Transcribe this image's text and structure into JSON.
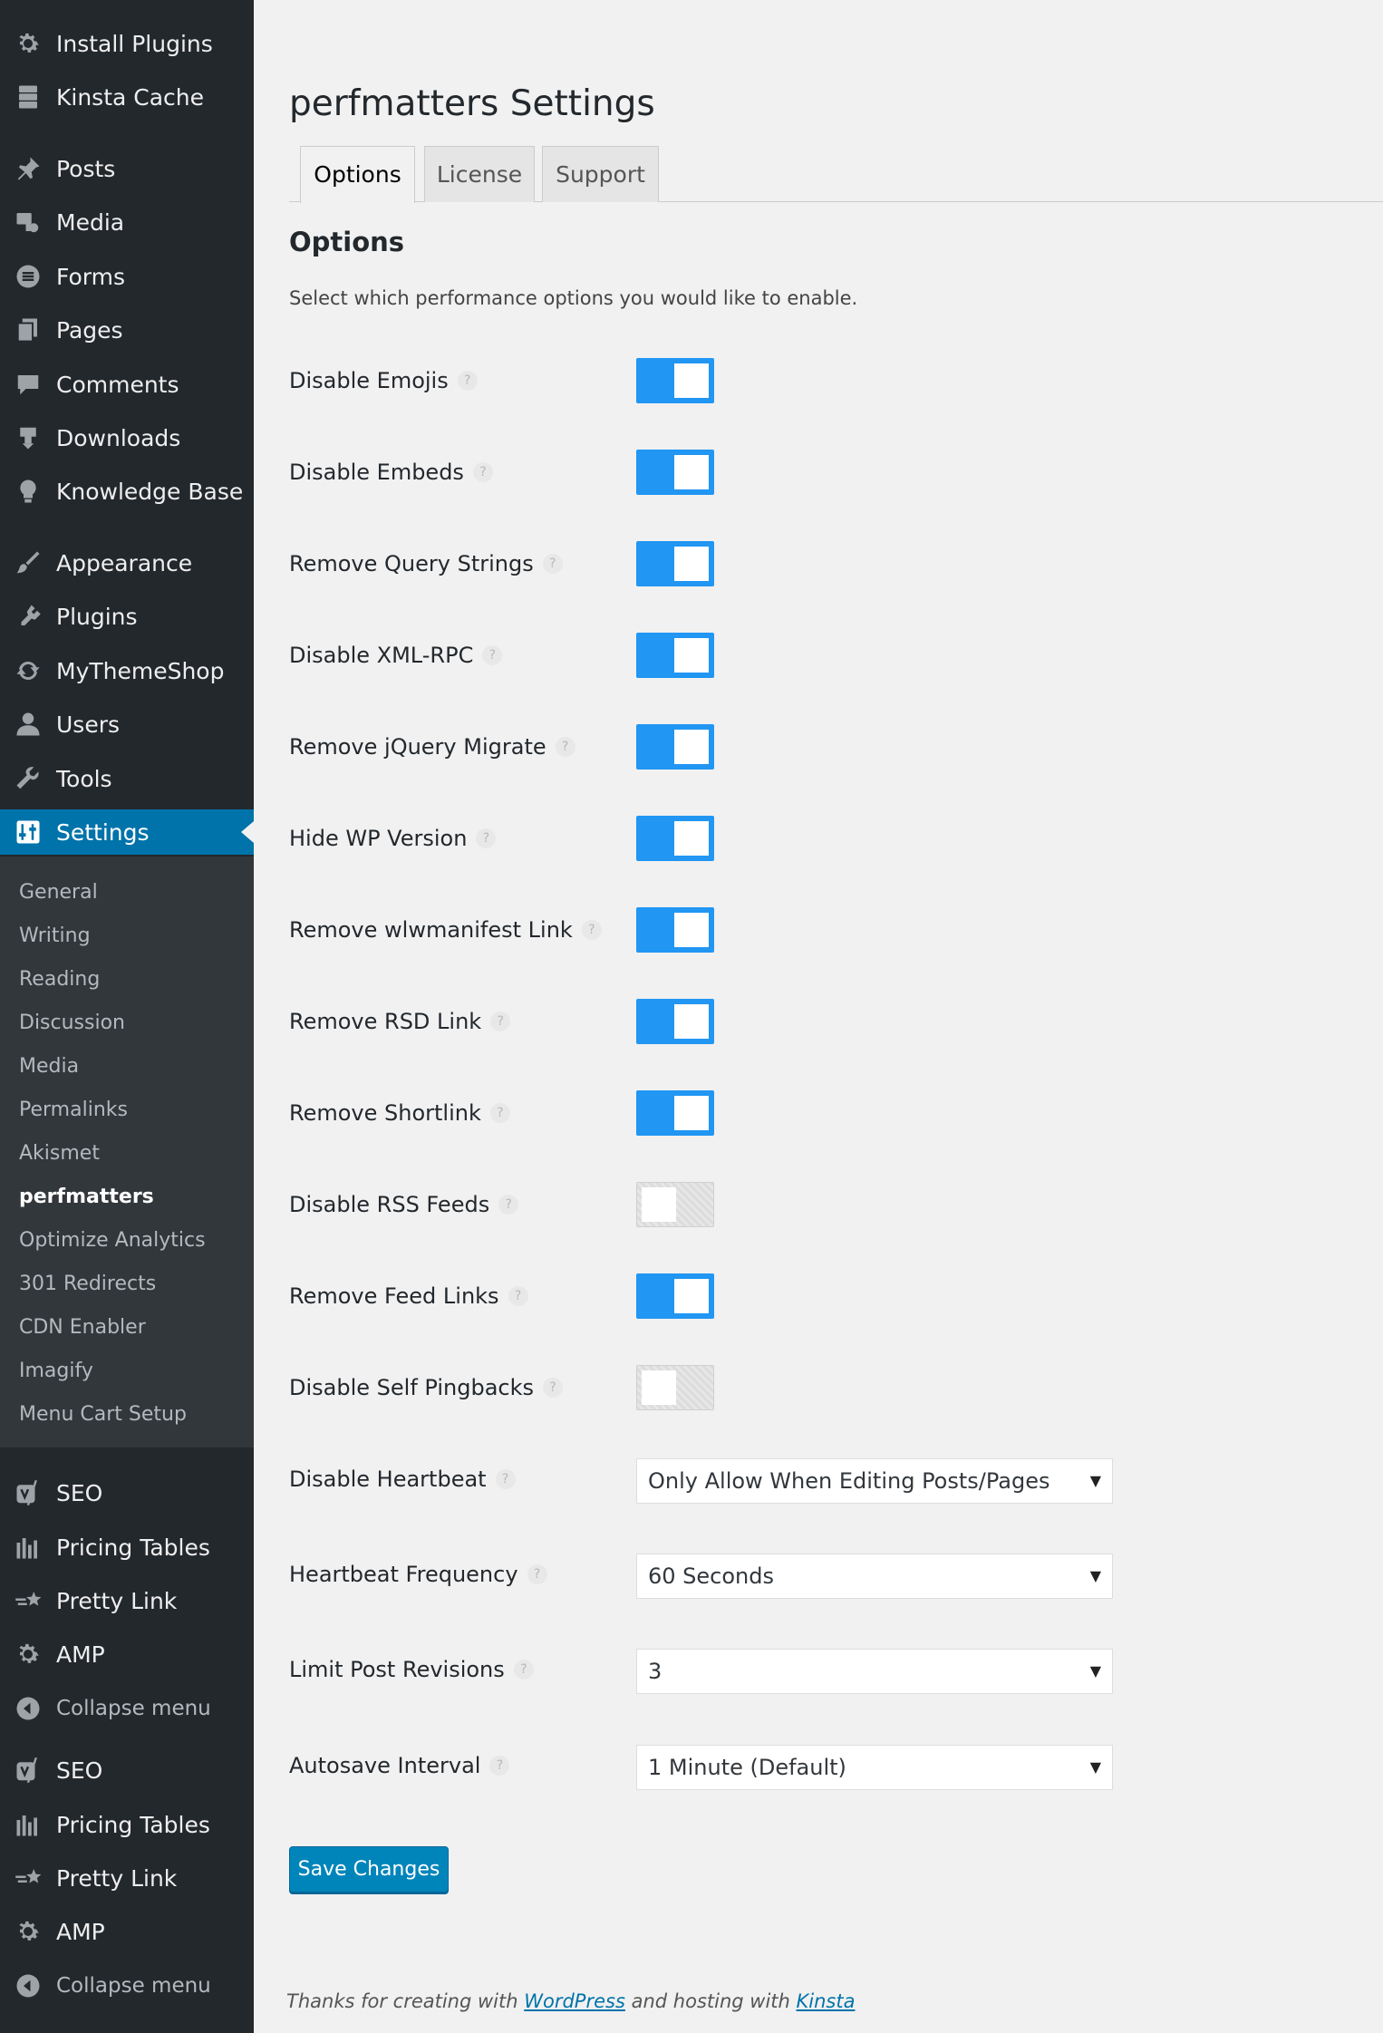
{
  "sidebar": {
    "top_items": [
      {
        "label": "Install Plugins",
        "icon": "gear-icon"
      },
      {
        "label": "Kinsta Cache",
        "icon": "server-icon"
      },
      {
        "label": "Posts",
        "icon": "pushpin-icon"
      },
      {
        "label": "Media",
        "icon": "media-icon"
      },
      {
        "label": "Forms",
        "icon": "forms-icon"
      },
      {
        "label": "Pages",
        "icon": "pages-icon"
      },
      {
        "label": "Comments",
        "icon": "comment-icon"
      },
      {
        "label": "Downloads",
        "icon": "download-icon"
      },
      {
        "label": "Knowledge Base",
        "icon": "lightbulb-icon"
      },
      {
        "label": "Appearance",
        "icon": "paintbrush-icon"
      },
      {
        "label": "Plugins",
        "icon": "plug-icon"
      },
      {
        "label": "MyThemeShop",
        "icon": "refresh-icon"
      },
      {
        "label": "Users",
        "icon": "user-icon"
      },
      {
        "label": "Tools",
        "icon": "wrench-icon"
      },
      {
        "label": "Settings",
        "icon": "settings-sliders-icon"
      }
    ],
    "submenu": [
      "General",
      "Writing",
      "Reading",
      "Discussion",
      "Media",
      "Permalinks",
      "Akismet",
      "perfmatters",
      "Optimize Analytics",
      "301 Redirects",
      "CDN Enabler",
      "Imagify",
      "Menu Cart Setup"
    ],
    "bottom_items": [
      {
        "label": "SEO",
        "icon": "yoast-icon"
      },
      {
        "label": "Pricing Tables",
        "icon": "bar-chart-icon"
      },
      {
        "label": "Pretty Link",
        "icon": "star-link-icon"
      },
      {
        "label": "AMP",
        "icon": "gear-icon"
      },
      {
        "label": "Collapse menu",
        "icon": "collapse-arrow-icon"
      },
      {
        "label": "SEO",
        "icon": "yoast-icon"
      },
      {
        "label": "Pricing Tables",
        "icon": "bar-chart-icon"
      },
      {
        "label": "Pretty Link",
        "icon": "star-link-icon"
      },
      {
        "label": "AMP",
        "icon": "gear-icon"
      },
      {
        "label": "Collapse menu",
        "icon": "collapse-arrow-icon"
      }
    ]
  },
  "page": {
    "title": "perfmatters Settings",
    "tabs": [
      "Options",
      "License",
      "Support"
    ],
    "section_title": "Options",
    "section_desc": "Select which performance options you would like to enable.",
    "help_glyph": "?"
  },
  "toggles": [
    {
      "label": "Disable Emojis",
      "enabled": true
    },
    {
      "label": "Disable Embeds",
      "enabled": true
    },
    {
      "label": "Remove Query Strings",
      "enabled": true
    },
    {
      "label": "Disable XML-RPC",
      "enabled": true
    },
    {
      "label": "Remove jQuery Migrate",
      "enabled": true
    },
    {
      "label": "Hide WP Version",
      "enabled": true
    },
    {
      "label": "Remove wlwmanifest Link",
      "enabled": true
    },
    {
      "label": "Remove RSD Link",
      "enabled": true
    },
    {
      "label": "Remove Shortlink",
      "enabled": true
    },
    {
      "label": "Disable RSS Feeds",
      "enabled": false
    },
    {
      "label": "Remove Feed Links",
      "enabled": true
    },
    {
      "label": "Disable Self Pingbacks",
      "enabled": false
    }
  ],
  "selects": [
    {
      "label": "Disable Heartbeat",
      "value": "Only Allow When Editing Posts/Pages"
    },
    {
      "label": "Heartbeat Frequency",
      "value": "60 Seconds"
    },
    {
      "label": "Limit Post Revisions",
      "value": "3"
    },
    {
      "label": "Autosave Interval",
      "value": "1 Minute (Default)"
    }
  ],
  "save_label": "Save Changes",
  "footer": {
    "prefix": "Thanks for creating with ",
    "wordpress": "WordPress",
    "middle": " and hosting with ",
    "kinsta": "Kinsta"
  },
  "colors": {
    "accent": "#0073aa",
    "toggle_on": "#2196f3",
    "sidebar_bg": "#23282d"
  }
}
